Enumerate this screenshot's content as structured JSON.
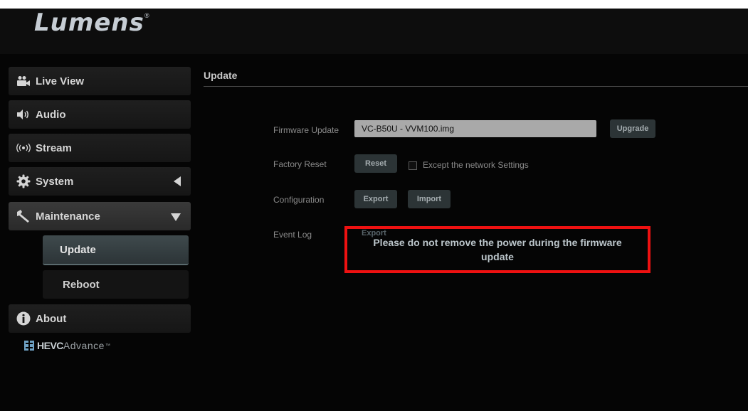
{
  "brand": {
    "logo_text": "Lumens",
    "registered_mark": "®"
  },
  "sidebar": {
    "items": [
      {
        "label": "Live View",
        "icon": "camera-icon"
      },
      {
        "label": "Audio",
        "icon": "speaker-icon"
      },
      {
        "label": "Stream",
        "icon": "broadcast-icon"
      },
      {
        "label": "System",
        "icon": "gear-icon"
      },
      {
        "label": "Maintenance",
        "icon": "wrench-icon"
      },
      {
        "label": "About",
        "icon": "info-icon"
      }
    ],
    "maintenance_sub": [
      {
        "label": "Update",
        "active": true
      },
      {
        "label": "Reboot",
        "active": false
      }
    ]
  },
  "footer_logo": {
    "mark": "HEVC",
    "bold": "HEVC",
    "light": "Advance",
    "tm": "™"
  },
  "page": {
    "title": "Update",
    "firmware": {
      "label": "Firmware Update",
      "value": "VC-B50U - VVM100.img",
      "upgrade_label": "Upgrade"
    },
    "factory_reset": {
      "label": "Factory Reset",
      "reset_label": "Reset",
      "checkbox_label": "Except the network Settings",
      "checked": false
    },
    "configuration": {
      "label": "Configuration",
      "export_label": "Export",
      "import_label": "Import"
    },
    "event_log": {
      "label": "Event Log",
      "export_label": "Export"
    },
    "warning": "Please do not remove the power during the firmware update"
  },
  "colors": {
    "background": "#050505",
    "warning_border": "#ee1111",
    "button_bg": "#2c3436"
  }
}
